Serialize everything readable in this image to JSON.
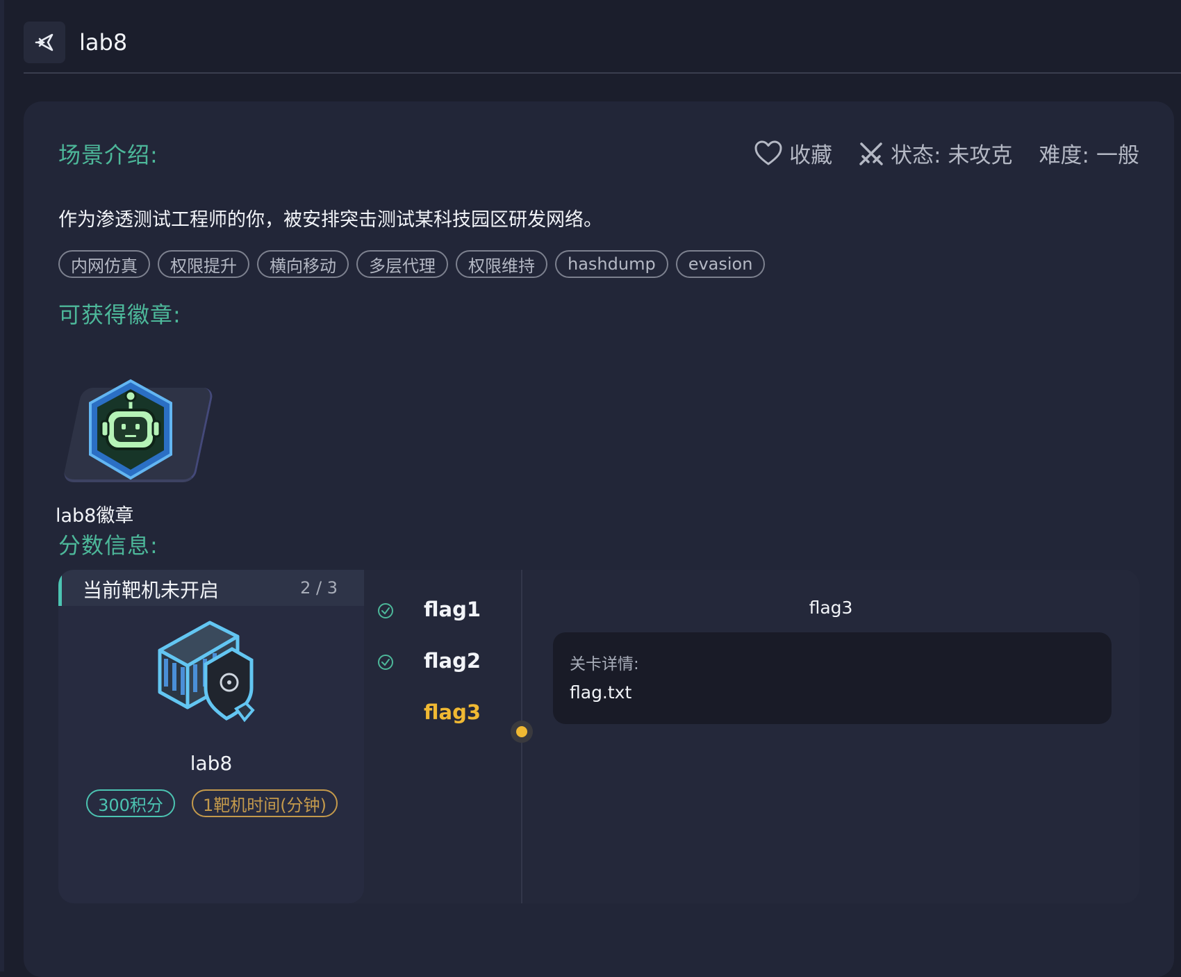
{
  "header": {
    "title": "lab8",
    "back_icon": "back-arrow-icon"
  },
  "scene": {
    "section_title": "场景介绍:",
    "description": "作为渗透测试工程师的你，被安排突击测试某科技园区研发网络。",
    "tags": [
      "内网仿真",
      "权限提升",
      "横向移动",
      "多层代理",
      "权限维持",
      "hashdump",
      "evasion"
    ]
  },
  "actions": {
    "favorite_label": "收藏",
    "status_label": "状态:",
    "status_value": "未攻克",
    "difficulty_label": "难度:",
    "difficulty_value": "一般"
  },
  "badges": {
    "section_title": "可获得徽章:",
    "items": [
      {
        "label": "lab8徽章",
        "icon": "robot-badge-icon"
      }
    ]
  },
  "score": {
    "section_title": "分数信息:",
    "machine": {
      "status": "当前靶机未开启",
      "progress": "2 / 3",
      "name": "lab8",
      "icon": "server-shield-icon",
      "points": "300积分",
      "time": "1靶机时间(分钟)"
    },
    "flags": [
      {
        "label": "flag1",
        "state": "completed"
      },
      {
        "label": "flag2",
        "state": "completed"
      },
      {
        "label": "flag3",
        "state": "active"
      }
    ],
    "detail": {
      "title": "flag3",
      "label": "关卡详情:",
      "value": "flag.txt"
    }
  },
  "colors": {
    "background": "#1b1e2c",
    "card": "#222638",
    "accent_green": "#4db89a",
    "teal": "#4cc4b2",
    "active_flag": "#f0b933",
    "time_pill": "#c49a4c"
  }
}
